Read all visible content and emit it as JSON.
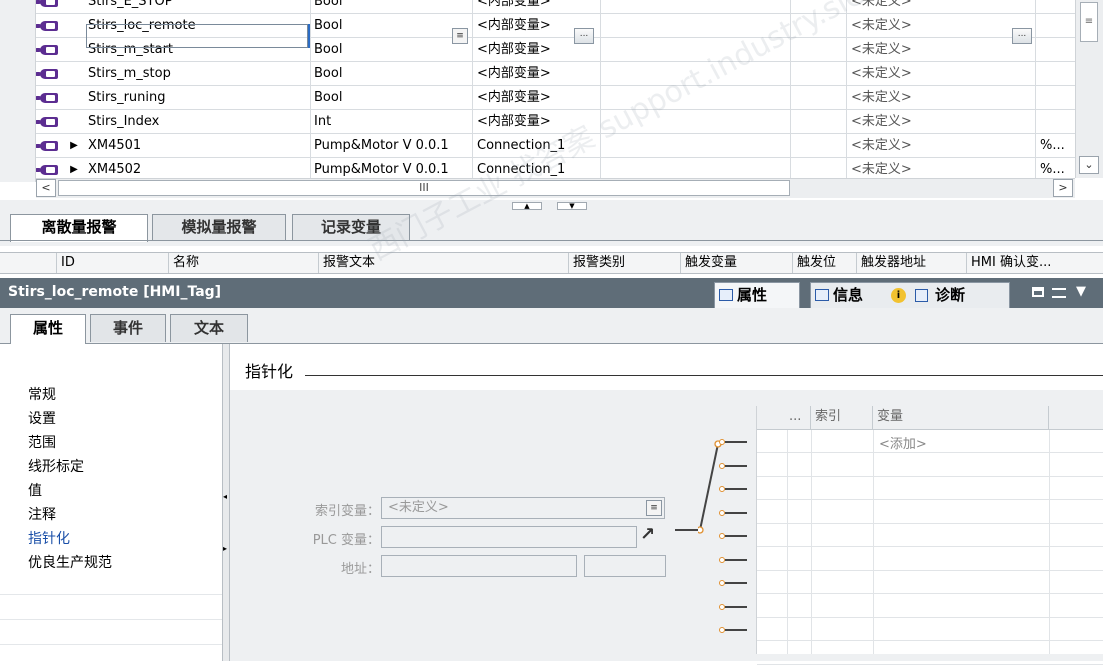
{
  "tag_table": {
    "rows": [
      {
        "name": "Stirs_E_STOP",
        "datatype": "Bool",
        "connection": "<内部变量>",
        "acq": "<未定义>",
        "addr": "",
        "expand": ""
      },
      {
        "name": "Stirs_loc_remote",
        "datatype": "Bool",
        "connection": "<内部变量>",
        "acq": "<未定义>",
        "addr": "",
        "expand": ""
      },
      {
        "name": "Stirs_m_start",
        "datatype": "Bool",
        "connection": "<内部变量>",
        "acq": "<未定义>",
        "addr": "",
        "expand": ""
      },
      {
        "name": "Stirs_m_stop",
        "datatype": "Bool",
        "connection": "<内部变量>",
        "acq": "<未定义>",
        "addr": "",
        "expand": ""
      },
      {
        "name": "Stirs_runing",
        "datatype": "Bool",
        "connection": "<内部变量>",
        "acq": "<未定义>",
        "addr": "",
        "expand": ""
      },
      {
        "name": "Stirs_Index",
        "datatype": "Int",
        "connection": "<内部变量>",
        "acq": "<未定义>",
        "addr": "",
        "expand": ""
      },
      {
        "name": "XM4501",
        "datatype": "Pump&Motor V 0.0.1",
        "connection": "Connection_1",
        "acq": "<未定义>",
        "addr": "%...",
        "expand": "▶"
      },
      {
        "name": "XM4502",
        "datatype": "Pump&Motor V 0.0.1",
        "connection": "Connection_1",
        "acq": "<未定义>",
        "addr": "%...",
        "expand": "▶"
      }
    ],
    "hscroll_grip": "III",
    "dots": "..."
  },
  "alarm_tabs": [
    "离散量报警",
    "模拟量报警",
    "记录变量"
  ],
  "alarm_columns": [
    "ID",
    "名称",
    "报警文本",
    "报警类别",
    "触发变量",
    "触发位",
    "触发器地址",
    "HMI 确认变..."
  ],
  "inspector": {
    "title": "Stirs_loc_remote [HMI_Tag]",
    "tabs": [
      "属性",
      "信息",
      "诊断"
    ],
    "info_badge": "i"
  },
  "sub_tabs": [
    "属性",
    "事件",
    "文本"
  ],
  "nav_items": [
    "常规",
    "设置",
    "范围",
    "线形标定",
    "值",
    "注释",
    "指针化",
    "优良生产规范"
  ],
  "section": {
    "title": "指针化",
    "index_var_label": "索引变量：",
    "index_var_value": "<未定义>",
    "plc_var_label": "PLC 变量：",
    "plc_var_value": "",
    "address_label": "地址：",
    "address_value": ""
  },
  "pointer_table": {
    "headers": [
      "...",
      "索引",
      "变量"
    ],
    "add_text": "<添加>"
  },
  "watermark": "西门子工业 找答案 support.industry.siemens.com"
}
